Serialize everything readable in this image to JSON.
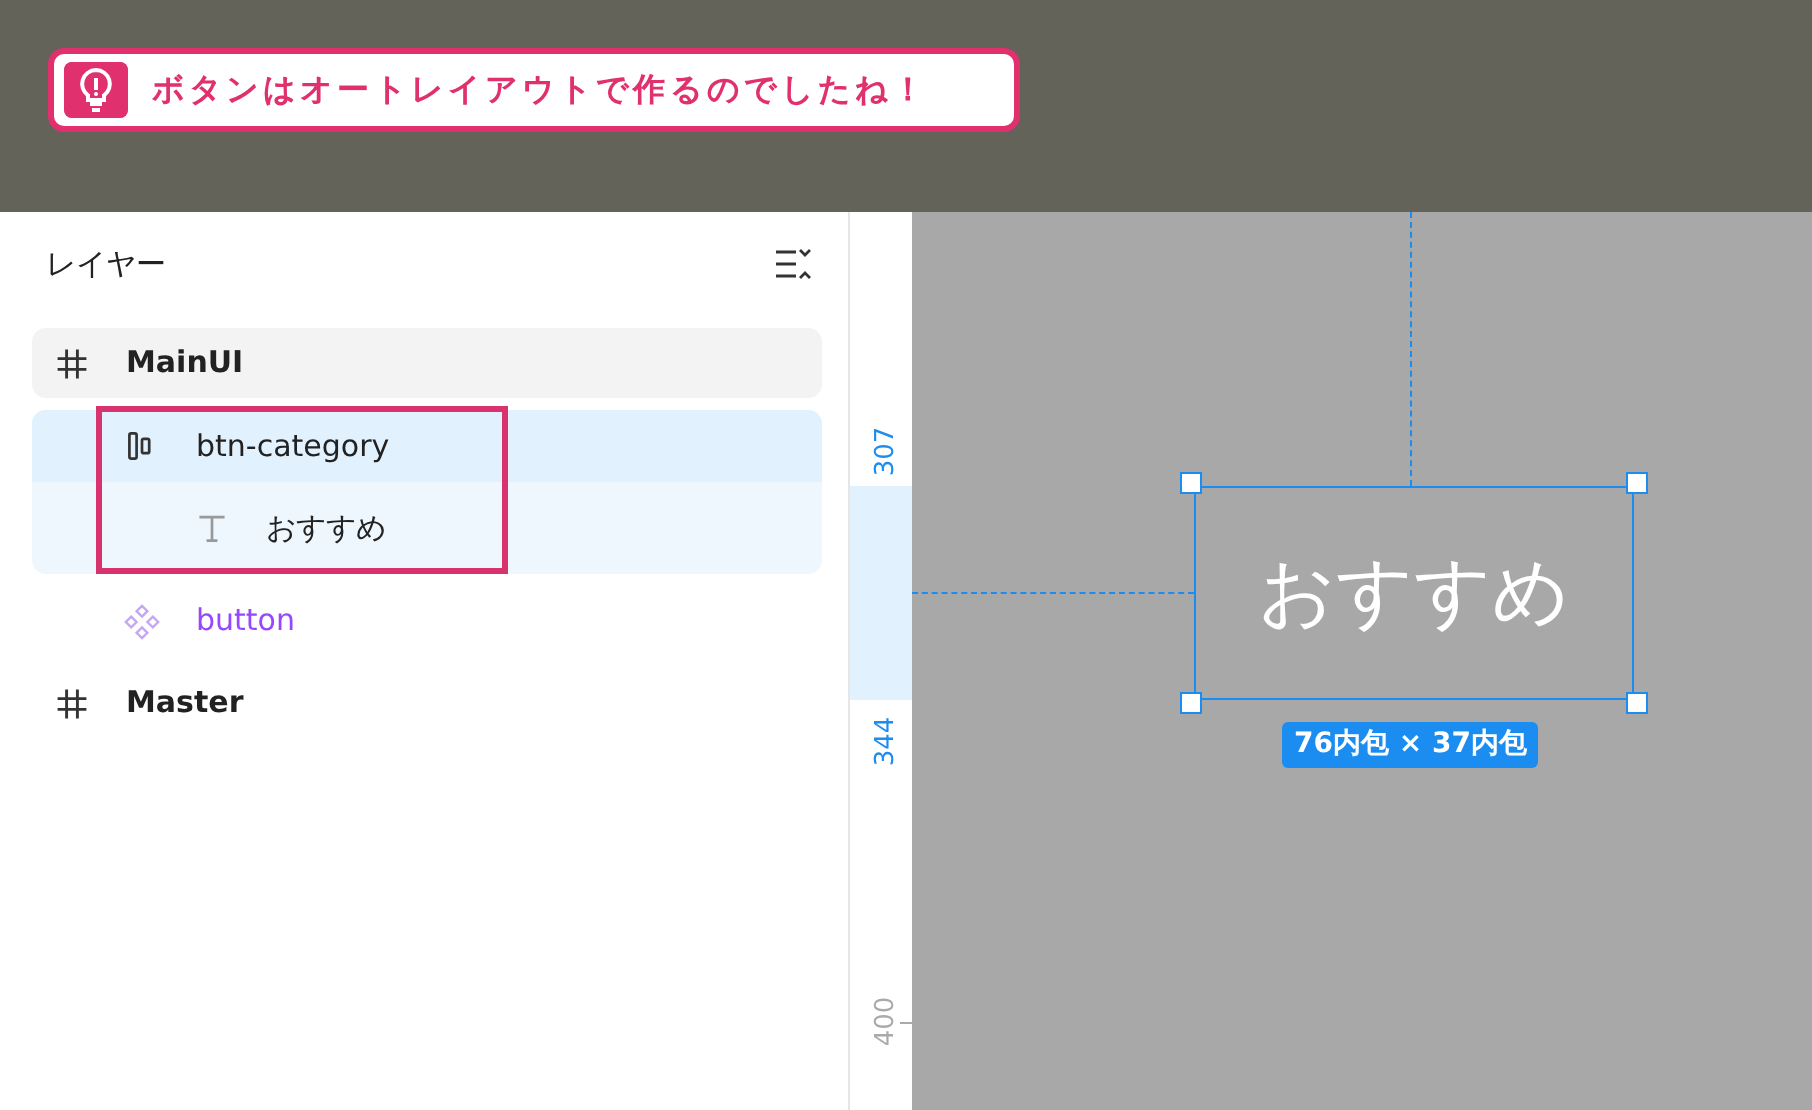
{
  "callout": {
    "text": "ボタンはオートレイアウトで作るのでしたね！"
  },
  "layers_panel": {
    "title": "レイヤー",
    "tree": [
      {
        "kind": "frame",
        "label": "MainUI",
        "hovered": true,
        "selected": false,
        "children": [
          {
            "kind": "autolayout",
            "label": "btn-category",
            "hovered": false,
            "selected": true,
            "annotated": true,
            "children": [
              {
                "kind": "text",
                "label": "おすすめ",
                "hovered": false,
                "selected": false
              }
            ]
          },
          {
            "kind": "component",
            "label": "button",
            "hovered": false,
            "selected": false
          }
        ]
      },
      {
        "kind": "frame",
        "label": "Master",
        "hovered": false,
        "selected": false
      }
    ]
  },
  "ruler": {
    "labels": [
      {
        "text": "307",
        "kind": "selection"
      },
      {
        "text": "344",
        "kind": "selection"
      },
      {
        "text": "400",
        "kind": "tick"
      }
    ]
  },
  "canvas": {
    "element": {
      "text": "おすすめ",
      "selected": true
    },
    "size_label": "76内包 × 37内包"
  }
}
